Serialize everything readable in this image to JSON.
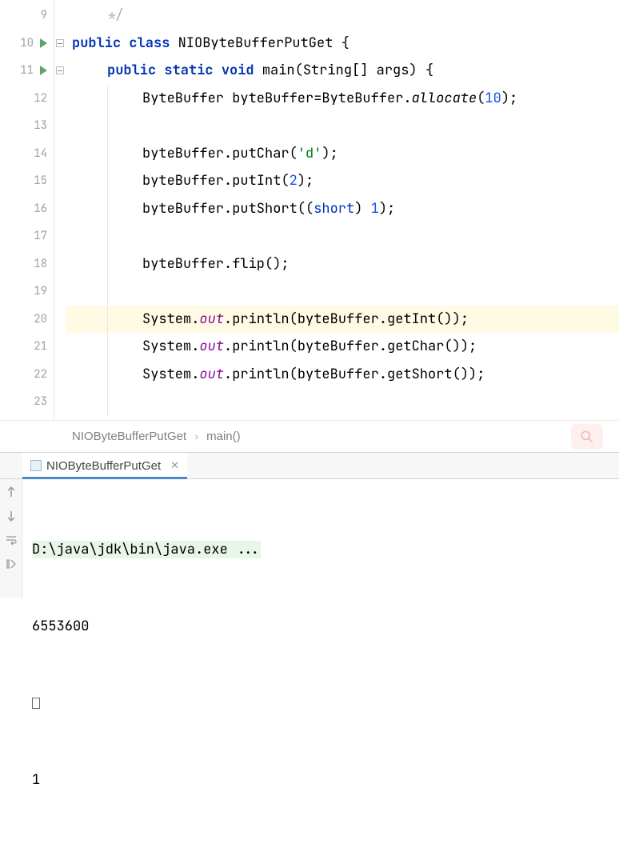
{
  "gutter": {
    "start": 9,
    "end": 23,
    "runnable_lines": [
      10,
      11
    ]
  },
  "code": {
    "lines": [
      {
        "n": 9,
        "indent": 1,
        "tokens": [
          {
            "t": "*/",
            "c": "gray-star"
          }
        ]
      },
      {
        "n": 10,
        "indent": 0,
        "tokens": [
          {
            "t": "public ",
            "c": "kw"
          },
          {
            "t": "class ",
            "c": "kw"
          },
          {
            "t": "NIOByteBufferPutGet ",
            "c": "cls"
          },
          {
            "t": "{",
            "c": "paren"
          }
        ]
      },
      {
        "n": 11,
        "indent": 1,
        "tokens": [
          {
            "t": "public ",
            "c": "kw"
          },
          {
            "t": "static ",
            "c": "kw"
          },
          {
            "t": "void ",
            "c": "kw"
          },
          {
            "t": "main",
            "c": "method"
          },
          {
            "t": "(String[] args) {",
            "c": "plain"
          }
        ]
      },
      {
        "n": 12,
        "indent": 2,
        "tokens": [
          {
            "t": "ByteBuffer byteBuffer=ByteBuffer.",
            "c": "plain"
          },
          {
            "t": "allocate",
            "c": "static-italic"
          },
          {
            "t": "(",
            "c": "paren"
          },
          {
            "t": "10",
            "c": "num"
          },
          {
            "t": ");",
            "c": "paren"
          }
        ]
      },
      {
        "n": 13,
        "indent": 2,
        "tokens": []
      },
      {
        "n": 14,
        "indent": 2,
        "tokens": [
          {
            "t": "byteBuffer.putChar(",
            "c": "plain"
          },
          {
            "t": "'d'",
            "c": "str"
          },
          {
            "t": ");",
            "c": "paren"
          }
        ]
      },
      {
        "n": 15,
        "indent": 2,
        "tokens": [
          {
            "t": "byteBuffer.putInt(",
            "c": "plain"
          },
          {
            "t": "2",
            "c": "num"
          },
          {
            "t": ");",
            "c": "paren"
          }
        ]
      },
      {
        "n": 16,
        "indent": 2,
        "tokens": [
          {
            "t": "byteBuffer.putShort((",
            "c": "plain"
          },
          {
            "t": "short",
            "c": "kw-nb"
          },
          {
            "t": ") ",
            "c": "plain"
          },
          {
            "t": "1",
            "c": "num"
          },
          {
            "t": ");",
            "c": "paren"
          }
        ]
      },
      {
        "n": 17,
        "indent": 2,
        "tokens": []
      },
      {
        "n": 18,
        "indent": 2,
        "tokens": [
          {
            "t": "byteBuffer.flip();",
            "c": "plain"
          }
        ]
      },
      {
        "n": 19,
        "indent": 2,
        "tokens": []
      },
      {
        "n": 20,
        "indent": 2,
        "highlight": true,
        "tokens": [
          {
            "t": "System.",
            "c": "plain"
          },
          {
            "t": "out",
            "c": "field-italic"
          },
          {
            "t": ".println(byteBuffer.getInt());",
            "c": "plain"
          }
        ]
      },
      {
        "n": 21,
        "indent": 2,
        "tokens": [
          {
            "t": "System.",
            "c": "plain"
          },
          {
            "t": "out",
            "c": "field-italic"
          },
          {
            "t": ".println(byteBuffer.getChar());",
            "c": "plain"
          }
        ]
      },
      {
        "n": 22,
        "indent": 2,
        "tokens": [
          {
            "t": "System.",
            "c": "plain"
          },
          {
            "t": "out",
            "c": "field-italic"
          },
          {
            "t": ".println(byteBuffer.getShort());",
            "c": "plain"
          }
        ]
      },
      {
        "n": 23,
        "indent": 2,
        "tokens": []
      }
    ]
  },
  "breadcrumb": {
    "cls": "NIOByteBufferPutGet",
    "method": "main()"
  },
  "run_tab": {
    "label": "NIOByteBufferPutGet"
  },
  "console": {
    "cmd": "D:\\java\\jdk\\bin\\java.exe ...",
    "out1": "6553600",
    "out2_is_box": true,
    "out3": "1"
  }
}
